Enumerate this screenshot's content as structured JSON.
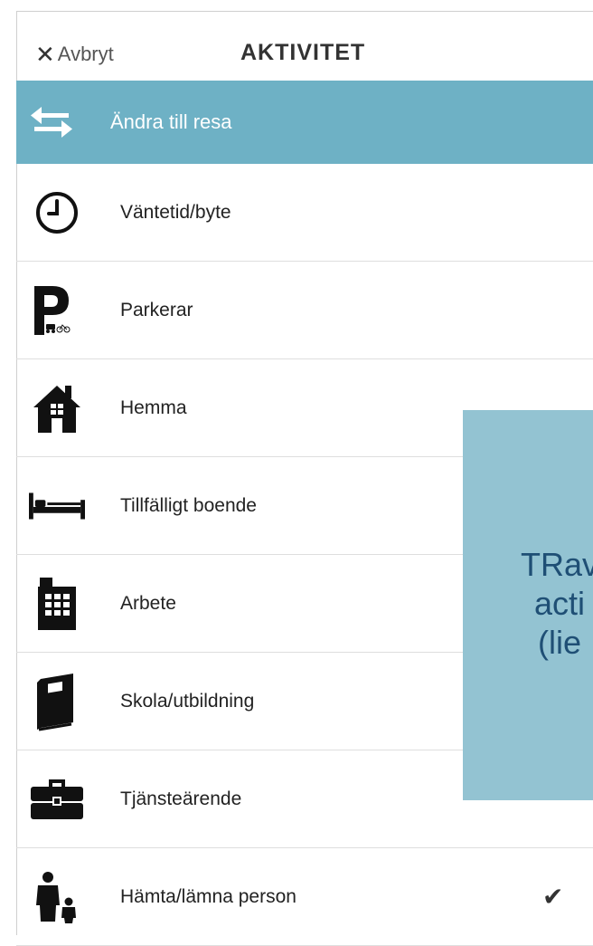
{
  "header": {
    "cancel_icon": "close-icon",
    "cancel_label": "Avbryt",
    "title": "AKTIVITET"
  },
  "change_bar": {
    "icon": "swap-arrows-icon",
    "label": "Ändra till resa",
    "color": "#6eb1c5"
  },
  "items": [
    {
      "icon": "clock-icon",
      "label": "Väntetid/byte"
    },
    {
      "icon": "parking-icon",
      "label": "Parkerar"
    },
    {
      "icon": "house-icon",
      "label": "Hemma"
    },
    {
      "icon": "bed-icon",
      "label": "Tillfälligt boende"
    },
    {
      "icon": "office-building-icon",
      "label": "Arbete"
    },
    {
      "icon": "book-icon",
      "label": "Skola/utbildning"
    },
    {
      "icon": "briefcase-icon",
      "label": "Tjänsteärende"
    },
    {
      "icon": "adult-child-icon",
      "label": "Hämta/lämna person",
      "checkmark": "✔"
    }
  ],
  "overlay": {
    "lines": [
      "TRav",
      "acti",
      "(lie"
    ],
    "color": "#93c3d2"
  }
}
